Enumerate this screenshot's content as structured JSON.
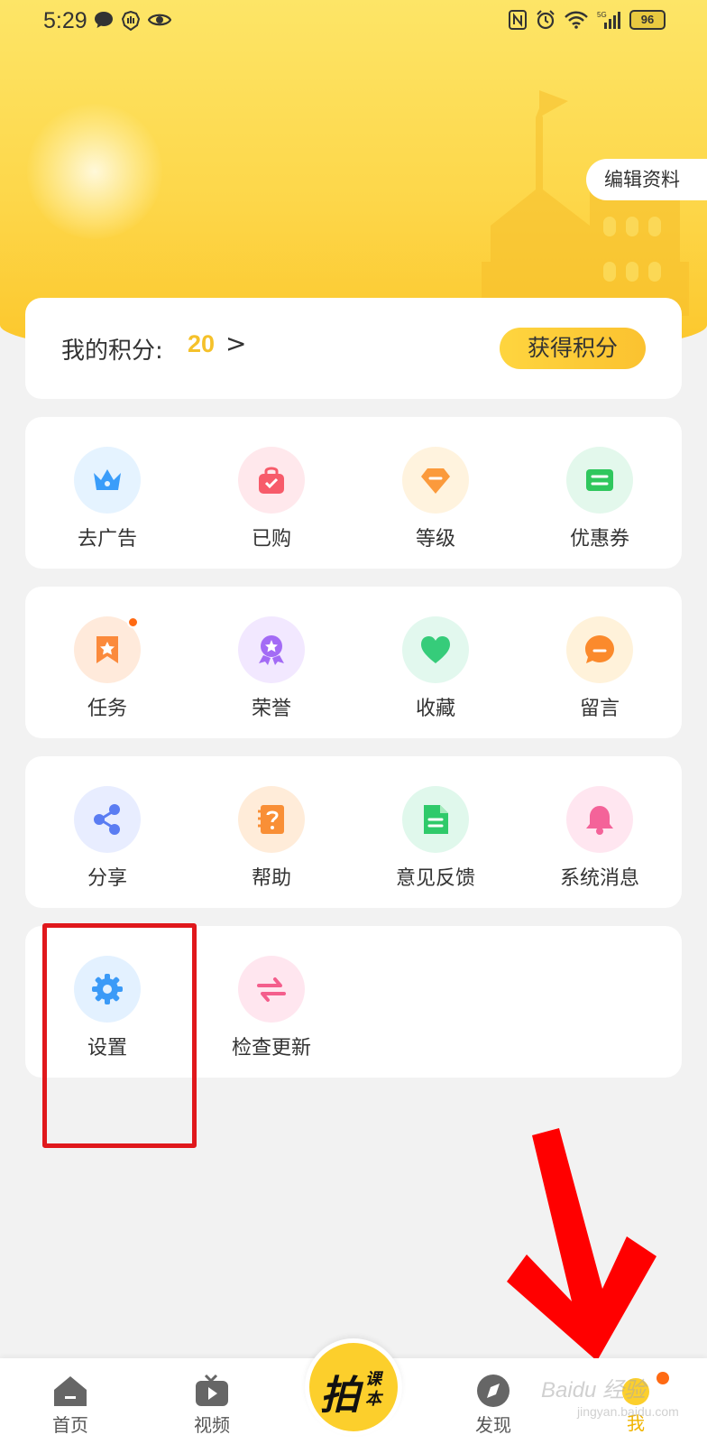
{
  "status_bar": {
    "time": "5:29",
    "battery": "96"
  },
  "header": {
    "edit_profile": "编辑资料"
  },
  "points": {
    "label": "我的积分:",
    "value": "20",
    "arrow": ">",
    "earn_button": "获得积分"
  },
  "rows": [
    [
      {
        "label": "去广告",
        "icon": "crown-icon",
        "bg": "#e5f3ff",
        "color": "#3a9dfa"
      },
      {
        "label": "已购",
        "icon": "shopping-bag-icon",
        "bg": "#ffe8ec",
        "color": "#f75b6a"
      },
      {
        "label": "等级",
        "icon": "diamond-icon",
        "bg": "#fff3de",
        "color": "#fb9a3c"
      },
      {
        "label": "优惠券",
        "icon": "coupon-icon",
        "bg": "#e3f8ec",
        "color": "#2fc75d"
      }
    ],
    [
      {
        "label": "任务",
        "icon": "bookmark-star-icon",
        "bg": "#ffeadb",
        "color": "#fb8a3c",
        "badge": true
      },
      {
        "label": "荣誉",
        "icon": "medal-icon",
        "bg": "#f2e8ff",
        "color": "#a36bf5"
      },
      {
        "label": "收藏",
        "icon": "heart-icon",
        "bg": "#e2f8ee",
        "color": "#36cc7a"
      },
      {
        "label": "留言",
        "icon": "message-icon",
        "bg": "#fff2da",
        "color": "#fb8a2c"
      }
    ],
    [
      {
        "label": "分享",
        "icon": "share-icon",
        "bg": "#e8edff",
        "color": "#5a7cf2"
      },
      {
        "label": "帮助",
        "icon": "help-book-icon",
        "bg": "#ffecd9",
        "color": "#f98f36"
      },
      {
        "label": "意见反馈",
        "icon": "feedback-document-icon",
        "bg": "#e0f8ec",
        "color": "#2fca6a"
      },
      {
        "label": "系统消息",
        "icon": "bell-icon",
        "bg": "#ffe6f0",
        "color": "#f46399"
      }
    ],
    [
      {
        "label": "设置",
        "icon": "gear-icon",
        "bg": "#e3f1ff",
        "color": "#3b9af7"
      },
      {
        "label": "检查更新",
        "icon": "refresh-arrows-icon",
        "bg": "#ffe6ef",
        "color": "#f45e8c"
      }
    ]
  ],
  "tabbar": {
    "home": "首页",
    "video": "视频",
    "camera_main": "拍",
    "camera_sub1": "课",
    "camera_sub2": "本",
    "discover": "发现",
    "me": "我"
  },
  "watermark": {
    "text": "Baidu 经验",
    "sub": "jingyan.baidu.com"
  }
}
